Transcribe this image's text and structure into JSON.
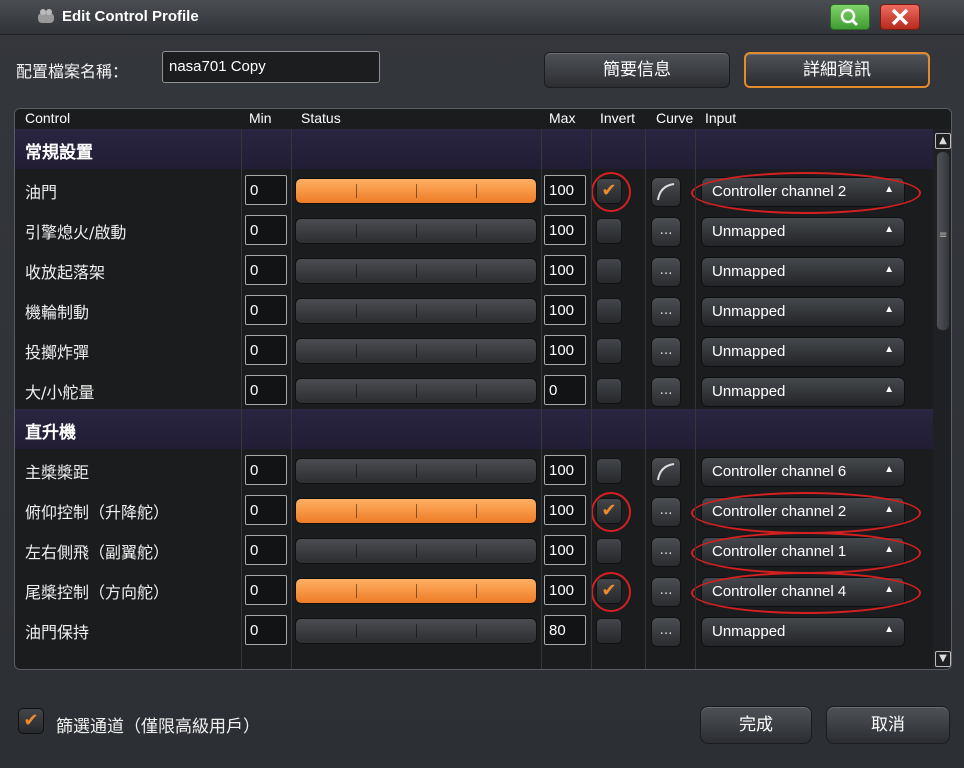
{
  "window": {
    "title": "Edit Control Profile"
  },
  "profile": {
    "name_label": "配置檔案名稱：",
    "name_value": "nasa701 Copy"
  },
  "buttons": {
    "summary": "簡要信息",
    "detail": "詳細資訊",
    "ok": "完成",
    "cancel": "取消"
  },
  "columns": {
    "control": "Control",
    "min": "Min",
    "status": "Status",
    "max": "Max",
    "invert": "Invert",
    "curve": "Curve",
    "input": "Input"
  },
  "sections": [
    {
      "title": "常規設置",
      "rows": [
        {
          "label": "油門",
          "min": "0",
          "max": "100",
          "fill": 1.0,
          "invert": true,
          "curve": "curve",
          "input": "Controller channel 2",
          "highlight": true
        },
        {
          "label": "引擎熄火/啟動",
          "min": "0",
          "max": "100",
          "fill": 0,
          "invert": false,
          "curve": "...",
          "input": "Unmapped",
          "highlight": false
        },
        {
          "label": "收放起落架",
          "min": "0",
          "max": "100",
          "fill": 0,
          "invert": false,
          "curve": "...",
          "input": "Unmapped",
          "highlight": false
        },
        {
          "label": "機輪制動",
          "min": "0",
          "max": "100",
          "fill": 0,
          "invert": false,
          "curve": "...",
          "input": "Unmapped",
          "highlight": false
        },
        {
          "label": "投擲炸彈",
          "min": "0",
          "max": "100",
          "fill": 0,
          "invert": false,
          "curve": "...",
          "input": "Unmapped",
          "highlight": false
        },
        {
          "label": "大/小舵量",
          "min": "0",
          "max": "0",
          "fill": 0,
          "invert": false,
          "curve": "...",
          "input": "Unmapped",
          "highlight": false
        }
      ]
    },
    {
      "title": "直升機",
      "rows": [
        {
          "label": "主槳槳距",
          "min": "0",
          "max": "100",
          "fill": 0,
          "invert": false,
          "curve": "curve",
          "input": "Controller channel 6",
          "highlight": false
        },
        {
          "label": "俯仰控制（升降舵）",
          "min": "0",
          "max": "100",
          "fill": 1.0,
          "invert": true,
          "curve": "...",
          "input": "Controller channel 2",
          "highlight": true
        },
        {
          "label": "左右側飛（副翼舵）",
          "min": "0",
          "max": "100",
          "fill": 0,
          "invert": false,
          "curve": "...",
          "input": "Controller channel 1",
          "highlight": true
        },
        {
          "label": "尾槳控制（方向舵）",
          "min": "0",
          "max": "100",
          "fill": 1.0,
          "invert": true,
          "curve": "...",
          "input": "Controller channel 4",
          "highlight": true
        },
        {
          "label": "油門保持",
          "min": "0",
          "max": "80",
          "fill": 0,
          "invert": false,
          "curve": "...",
          "input": "Unmapped",
          "highlight": false
        }
      ]
    }
  ],
  "footer": {
    "filter_checked": true,
    "filter_label": "篩選通道（僅限高級用戶）"
  },
  "colors": {
    "accent": "#ee7c26",
    "highlight": "#d42020",
    "section_bg": "#241f38"
  }
}
